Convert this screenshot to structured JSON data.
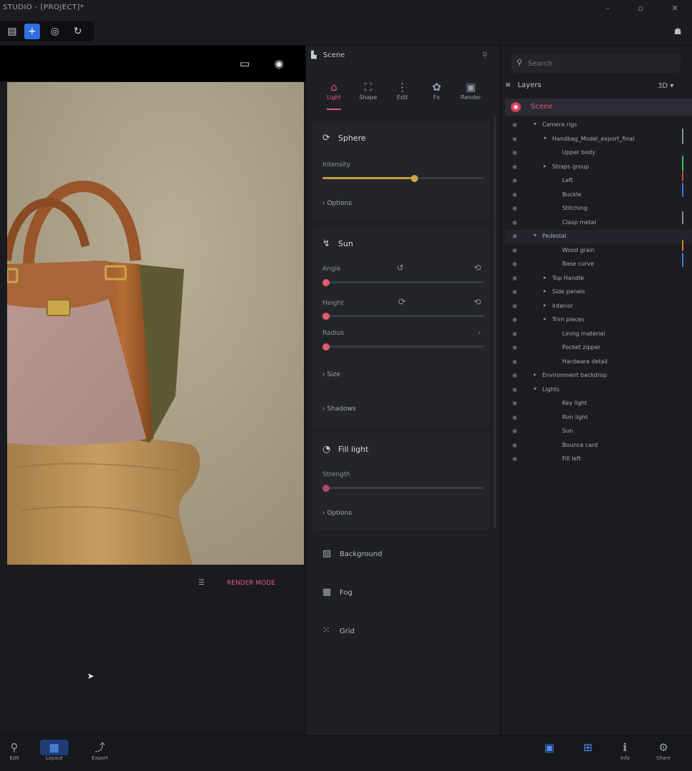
{
  "window": {
    "title": "STUDIO - [PROJECT]*"
  },
  "toolbar": {
    "tools": [
      {
        "name": "tool-select",
        "glyph": "▤"
      },
      {
        "name": "tool-add",
        "glyph": "+"
      },
      {
        "name": "tool-camera",
        "glyph": "◎"
      },
      {
        "name": "tool-rotate",
        "glyph": "↻"
      }
    ],
    "user_glyph": "☗"
  },
  "viewport": {
    "frame_glyph": "▭",
    "eye_glyph": "◉",
    "footer_list_glyph": "☰",
    "footer_status": "RENDER MODE"
  },
  "properties": {
    "header": "Scene",
    "tabs": [
      {
        "label": "Light",
        "glyph": "⌂"
      },
      {
        "label": "Shape",
        "glyph": "⛶"
      },
      {
        "label": "Edit",
        "glyph": "⋮"
      },
      {
        "label": "Fx",
        "glyph": "✿"
      },
      {
        "label": "Render",
        "glyph": "▣"
      }
    ],
    "sections": {
      "environment": {
        "title": "Sphere",
        "glyph": "⟳",
        "slider_label": "Intensity",
        "more": "› Options"
      },
      "transform": {
        "title": "Sun",
        "glyph": "↯",
        "row1": "Angle",
        "row2": "Height",
        "row3": "Radius",
        "more1": "› Size",
        "more2": "› Shadows"
      },
      "ambient": {
        "title": "Fill light",
        "glyph": "◔",
        "slider_label": "Strength",
        "more": "› Options"
      }
    },
    "extra_rows": [
      {
        "label": "Background",
        "glyph": "▨"
      },
      {
        "label": "Fog",
        "glyph": "▦"
      },
      {
        "label": "Grid",
        "glyph": "⁙"
      }
    ]
  },
  "layers": {
    "search_placeholder": "Search",
    "header": "Layers",
    "zoom": "3D ▾",
    "root": "Scene",
    "items": [
      {
        "name": "Camera rigs",
        "depth": 0,
        "twist": "▾"
      },
      {
        "name": "Handbag_Model_export_final",
        "depth": 1,
        "twist": "▾"
      },
      {
        "name": "Upper body",
        "depth": 2,
        "twist": ""
      },
      {
        "name": "Straps group",
        "depth": 1,
        "twist": "▸"
      },
      {
        "name": "Left",
        "depth": 2,
        "twist": ""
      },
      {
        "name": "Buckle",
        "depth": 2,
        "twist": ""
      },
      {
        "name": "Stitching",
        "depth": 2,
        "twist": ""
      },
      {
        "name": "Clasp metal",
        "depth": 2,
        "twist": ""
      },
      {
        "name": "Pedestal",
        "depth": 0,
        "twist": "▾",
        "selected": true
      },
      {
        "name": "Wood grain",
        "depth": 2,
        "twist": ""
      },
      {
        "name": "Base curve",
        "depth": 2,
        "twist": ""
      },
      {
        "name": "Top Handle",
        "depth": 1,
        "twist": "▸"
      },
      {
        "name": "Side panels",
        "depth": 1,
        "twist": "▸"
      },
      {
        "name": "Interior",
        "depth": 1,
        "twist": "▸"
      },
      {
        "name": "Trim pieces",
        "depth": 1,
        "twist": "▸"
      },
      {
        "name": "Lining material",
        "depth": 2,
        "twist": ""
      },
      {
        "name": "Pocket zipper",
        "depth": 2,
        "twist": ""
      },
      {
        "name": "Hardware detail",
        "depth": 2,
        "twist": ""
      },
      {
        "name": "Environment backdrop",
        "depth": 0,
        "twist": "▸"
      },
      {
        "name": "Lights",
        "depth": 0,
        "twist": "▾"
      },
      {
        "name": "Key light",
        "depth": 2,
        "twist": ""
      },
      {
        "name": "Rim light",
        "depth": 2,
        "twist": ""
      },
      {
        "name": "Sun",
        "depth": 2,
        "twist": ""
      },
      {
        "name": "Bounce card",
        "depth": 2,
        "twist": ""
      },
      {
        "name": "Fill left",
        "depth": 2,
        "twist": ""
      }
    ]
  },
  "bottom": {
    "left": [
      {
        "label": "Edit",
        "glyph": "⚲"
      },
      {
        "label": "Layout",
        "glyph": "▦"
      },
      {
        "label": "Export",
        "glyph": "⤴"
      }
    ],
    "right": [
      {
        "label": "",
        "glyph": "▣"
      },
      {
        "label": "",
        "glyph": "⊞"
      },
      {
        "label": "Info",
        "glyph": "ℹ"
      },
      {
        "label": "Share",
        "glyph": "⚙"
      }
    ]
  },
  "colors": {
    "accent": "#e35a72",
    "blue": "#2f6fe0",
    "slider_gold": "#c49a3a"
  }
}
